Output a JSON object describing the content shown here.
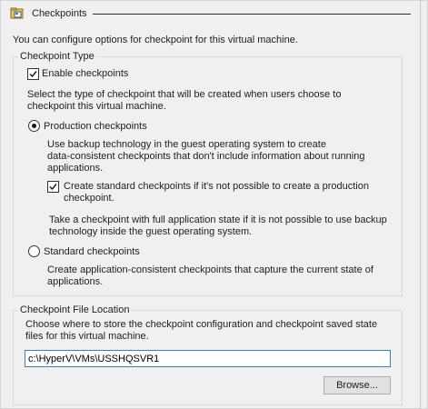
{
  "section": {
    "title": "Checkpoints",
    "icon": "checkpoint-folder-icon"
  },
  "intro_text": "You can configure options for checkpoint for this virtual machine.",
  "checkpoint_type": {
    "legend": "Checkpoint Type",
    "enable_label": "Enable checkpoints",
    "enable_checked": true,
    "select_type_text": [
      "Select the type of checkpoint that will be created when users choose to",
      "checkpoint this virtual machine."
    ],
    "production": {
      "label": "Production checkpoints",
      "selected": true,
      "description": [
        "Use backup technology in the guest operating system to create",
        "data-consistent checkpoints that don't include information about running",
        "applications."
      ],
      "fallback_label": [
        "Create standard checkpoints if it's not possible to create a production",
        "checkpoint."
      ],
      "fallback_checked": true,
      "fallback_note": [
        "Take a checkpoint with full application state if it is not possible to use backup",
        "technology inside the guest operating system."
      ]
    },
    "standard": {
      "label": "Standard checkpoints",
      "selected": false,
      "description": [
        "Create application-consistent checkpoints that capture the current state of",
        "applications."
      ]
    }
  },
  "file_location": {
    "legend": "Checkpoint File Location",
    "description": [
      "Choose where to store the checkpoint configuration and checkpoint saved state",
      "files for this virtual machine."
    ],
    "path_value": "c:\\HyperV\\VMs\\USSHQSVR1",
    "browse_label": "Browse..."
  },
  "colors": {
    "background": "#f0f0f0",
    "input_border": "#3c7fb1"
  }
}
